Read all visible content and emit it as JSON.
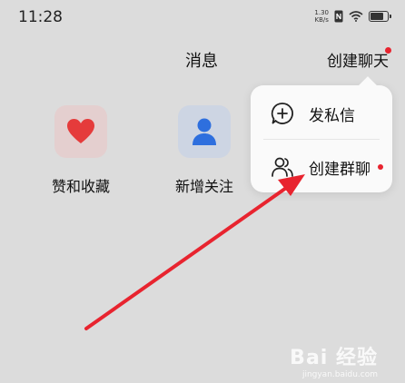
{
  "status_bar": {
    "time": "11:28",
    "net_speed_value": "1.30",
    "net_speed_unit": "KB/s",
    "battery_level": 0.75,
    "icons": [
      "nfc-icon",
      "wifi-icon",
      "battery-icon"
    ]
  },
  "header": {
    "title": "消息",
    "create_chat": "创建聊天",
    "badge_color": "#e8242f"
  },
  "quick_actions": [
    {
      "label": "赞和收藏",
      "icon": "heart-icon",
      "color": "#e53b3b"
    },
    {
      "label": "新增关注",
      "icon": "person-icon",
      "color": "#2e6fde"
    }
  ],
  "popup_menu": {
    "items": [
      {
        "label": "发私信",
        "icon": "plus-chat-icon"
      },
      {
        "label": "创建群聊",
        "icon": "group-icon",
        "has_badge": true
      }
    ]
  },
  "annotation": {
    "type": "arrow",
    "color": "#e8242f"
  },
  "watermark": {
    "text": "Bai 经验",
    "sub": "jingyan.baidu.com"
  }
}
